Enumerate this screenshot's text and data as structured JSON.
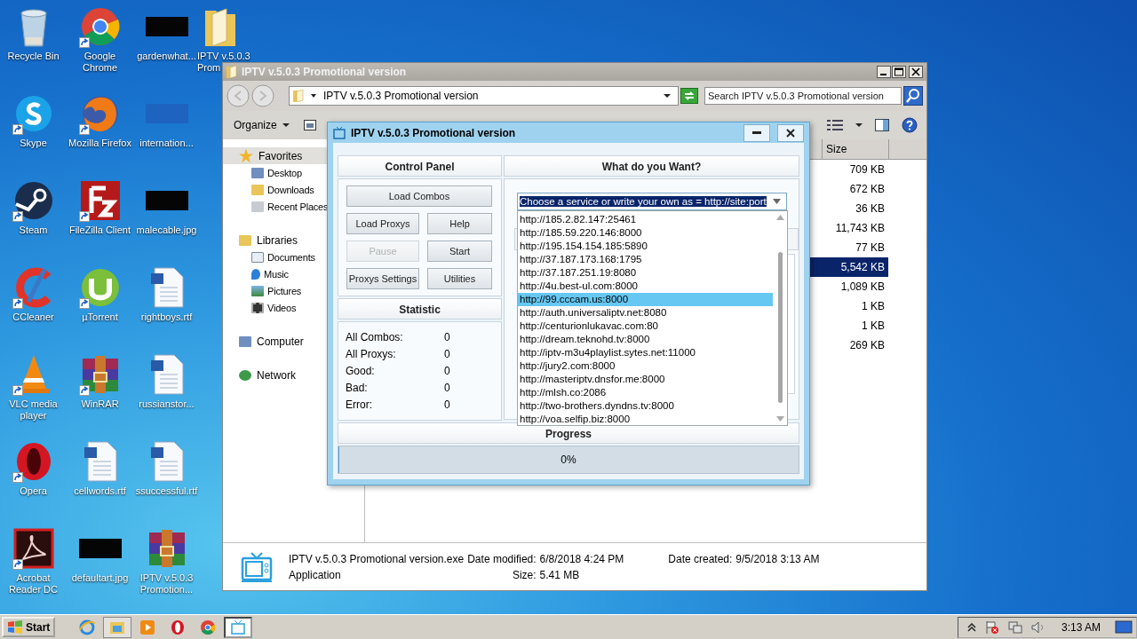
{
  "desktop": {
    "icons": [
      {
        "label": "Recycle Bin",
        "kind": "bin",
        "shortcut": false
      },
      {
        "label": "Skype",
        "kind": "skype",
        "shortcut": true
      },
      {
        "label": "Steam",
        "kind": "steam",
        "shortcut": true
      },
      {
        "label": "CCleaner",
        "kind": "ccleaner",
        "shortcut": true
      },
      {
        "label": "VLC media player",
        "kind": "vlc",
        "shortcut": true
      },
      {
        "label": "Opera",
        "kind": "opera",
        "shortcut": true
      },
      {
        "label": "Acrobat Reader DC",
        "kind": "acrobat",
        "shortcut": true
      },
      {
        "label": "Google Chrome",
        "kind": "chrome",
        "shortcut": true
      },
      {
        "label": "Mozilla Firefox",
        "kind": "firefox",
        "shortcut": true
      },
      {
        "label": "FileZilla Client",
        "kind": "filezilla",
        "shortcut": true
      },
      {
        "label": "µTorrent",
        "kind": "utorrent",
        "shortcut": true
      },
      {
        "label": "WinRAR",
        "kind": "winrar",
        "shortcut": true
      },
      {
        "label": "cellwords.rtf",
        "kind": "document",
        "shortcut": false
      },
      {
        "label": "defaultart.jpg",
        "kind": "thumbnail",
        "shortcut": false
      },
      {
        "label": "gardenwhat...",
        "kind": "thumbnail",
        "shortcut": false
      },
      {
        "label": "internation...",
        "kind": "bluethumb",
        "shortcut": false
      },
      {
        "label": "malecable.jpg",
        "kind": "thumbnail",
        "shortcut": false
      },
      {
        "label": "rightboys.rtf",
        "kind": "document",
        "shortcut": false
      },
      {
        "label": "russianstor...",
        "kind": "document",
        "shortcut": false
      },
      {
        "label": "ssuccessful.rtf",
        "kind": "document",
        "shortcut": false
      },
      {
        "label": "IPTV v.5.0.3 Promotion...",
        "kind": "winrar",
        "shortcut": false
      },
      {
        "label": "IPTV v.5.0.3",
        "label_2": "Prom",
        "kind": "folder",
        "shortcut": false
      }
    ]
  },
  "explorer": {
    "title": "IPTV v.5.0.3 Promotional version",
    "address": "IPTV v.5.0.3 Promotional version",
    "search": {
      "placeholder": "Search IPTV v.5.0.3 Promotional version"
    },
    "organize": "Organize",
    "nav": [
      {
        "label": "Favorites",
        "selected": true,
        "children": [
          {
            "label": "Desktop",
            "selected": false
          },
          {
            "label": "Downloads",
            "selected": false
          },
          {
            "label": "Recent Places",
            "selected": false
          }
        ]
      },
      {
        "label": "Libraries",
        "selected": false,
        "children": [
          {
            "label": "Documents",
            "selected": false
          },
          {
            "label": "Music",
            "selected": false
          },
          {
            "label": "Pictures",
            "selected": false
          },
          {
            "label": "Videos",
            "selected": false
          }
        ]
      },
      {
        "label": "Computer",
        "selected": false
      },
      {
        "label": "Network",
        "selected": false
      }
    ],
    "columns": [
      "Size"
    ],
    "files": [
      {
        "size": "709 KB",
        "selected": false
      },
      {
        "size": "672 KB",
        "selected": false
      },
      {
        "size": "36 KB",
        "selected": false
      },
      {
        "size": "11,743 KB",
        "selected": false
      },
      {
        "size": "77 KB",
        "selected": false
      },
      {
        "size": "5,542 KB",
        "selected": true
      },
      {
        "size": "1,089 KB",
        "selected": false
      },
      {
        "size": "1 KB",
        "selected": false
      },
      {
        "size": "1 KB",
        "selected": false
      },
      {
        "size": "269 KB",
        "selected": false
      }
    ],
    "details": {
      "name": "IPTV v.5.0.3 Promotional version.exe",
      "type": "Application",
      "modified_label": "Date modified:",
      "modified": "6/8/2018 4:24 PM",
      "size_label": "Size:",
      "size": "5.41 MB",
      "created_label": "Date created:",
      "created": "9/5/2018 3:13 AM"
    }
  },
  "dialog": {
    "title": "IPTV v.5.0.3 Promotional version",
    "control_panel": {
      "title": "Control Panel",
      "buttons": [
        {
          "label": "Load Combos",
          "disabled": false
        },
        {
          "label": "Load Proxys",
          "disabled": false
        },
        {
          "label": "Help",
          "disabled": false
        },
        {
          "label": "Pause",
          "disabled": true
        },
        {
          "label": "Start",
          "disabled": false
        },
        {
          "label": "Proxys Settings",
          "disabled": false
        },
        {
          "label": "Utilities",
          "disabled": false
        }
      ]
    },
    "statistic": {
      "title": "Statistic",
      "rows": [
        {
          "label": "All Combos:",
          "value": "0"
        },
        {
          "label": "All Proxys:",
          "value": "0"
        },
        {
          "label": "Good:",
          "value": "0"
        },
        {
          "label": "Bad:",
          "value": "0"
        },
        {
          "label": "Error:",
          "value": "0"
        }
      ]
    },
    "service": {
      "title": "What do you Want?",
      "value": "Choose a service or write your own as = http://site:port",
      "options": [
        {
          "text": "http://185.2.82.147:25461",
          "selected": false
        },
        {
          "text": "http://185.59.220.146:8000",
          "selected": false
        },
        {
          "text": "http://195.154.154.185:5890",
          "selected": false
        },
        {
          "text": "http://37.187.173.168:1795",
          "selected": false
        },
        {
          "text": "http://37.187.251.19:8080",
          "selected": false
        },
        {
          "text": "http://4u.best-ul.com:8000",
          "selected": false
        },
        {
          "text": "http://99.cccam.us:8000",
          "selected": true
        },
        {
          "text": "http://auth.universaliptv.net:8080",
          "selected": false
        },
        {
          "text": "http://centurionlukavac.com:80",
          "selected": false
        },
        {
          "text": "http://dream.teknohd.tv:8000",
          "selected": false
        },
        {
          "text": "http://iptv-m3u4playlist.sytes.net:11000",
          "selected": false
        },
        {
          "text": "http://jury2.com:8000",
          "selected": false
        },
        {
          "text": "http://masteriptv.dnsfor.me:8000",
          "selected": false
        },
        {
          "text": "http://mlsh.co:2086",
          "selected": false
        },
        {
          "text": "http://two-brothers.dyndns.tv:8000",
          "selected": false
        },
        {
          "text": "http://voa.selfip.biz:8000",
          "selected": false
        }
      ]
    },
    "progress": {
      "title": "Progress",
      "level": 0,
      "reading": "0%"
    }
  },
  "taskbar": {
    "start": "Start",
    "apps": [
      {
        "kind": "ie",
        "running": false,
        "active": false
      },
      {
        "kind": "explorer",
        "running": true,
        "active": false
      },
      {
        "kind": "media",
        "running": false,
        "active": false
      },
      {
        "kind": "opera",
        "running": false,
        "active": false
      },
      {
        "kind": "chrome",
        "running": false,
        "active": false
      },
      {
        "kind": "iptv",
        "running": true,
        "active": true
      }
    ],
    "clock": "3:13 AM"
  }
}
